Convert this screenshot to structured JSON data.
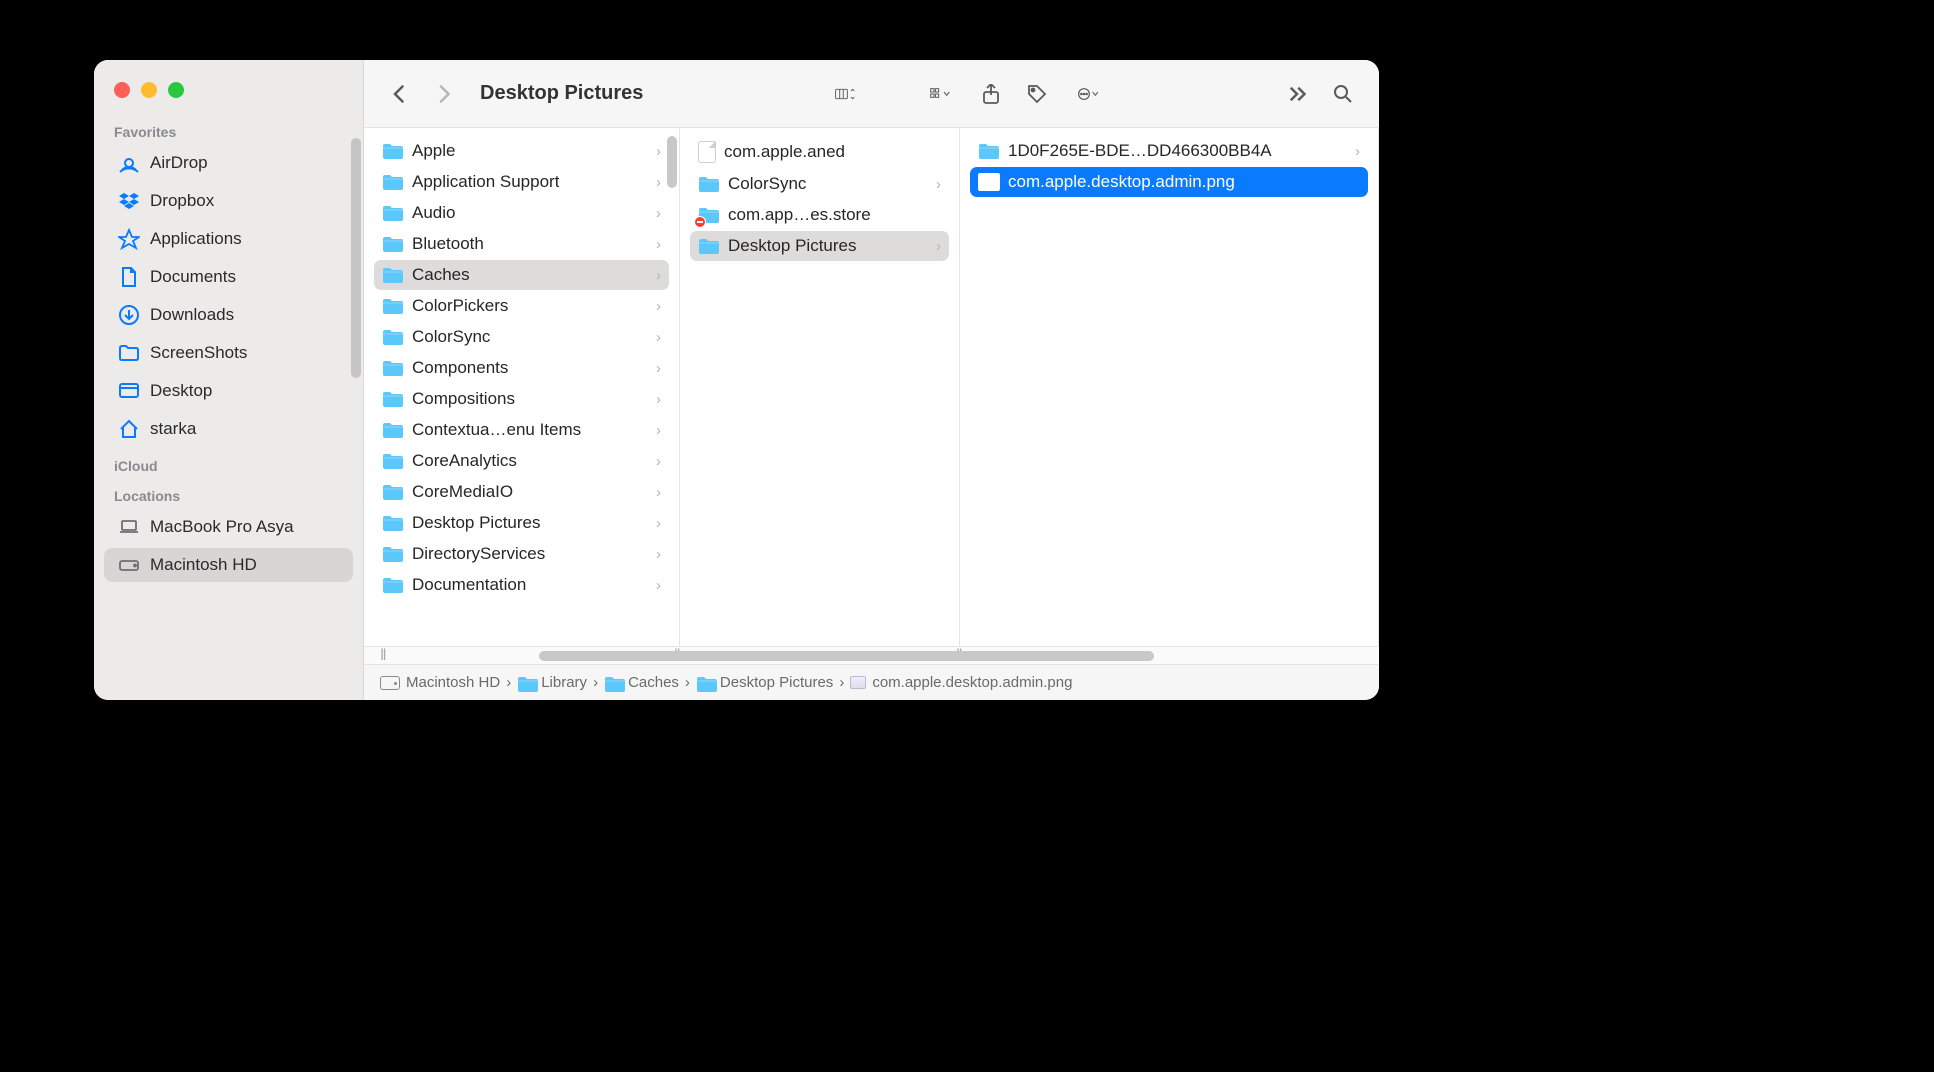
{
  "window": {
    "title": "Desktop Pictures"
  },
  "sidebar": {
    "sections": {
      "favorites": {
        "label": "Favorites",
        "items": [
          {
            "icon": "airdrop",
            "label": "AirDrop"
          },
          {
            "icon": "dropbox",
            "label": "Dropbox"
          },
          {
            "icon": "applications",
            "label": "Applications"
          },
          {
            "icon": "documents",
            "label": "Documents"
          },
          {
            "icon": "downloads",
            "label": "Downloads"
          },
          {
            "icon": "folder",
            "label": "ScreenShots"
          },
          {
            "icon": "desktop",
            "label": "Desktop"
          },
          {
            "icon": "home",
            "label": "starka"
          }
        ]
      },
      "icloud": {
        "label": "iCloud"
      },
      "locations": {
        "label": "Locations",
        "items": [
          {
            "icon": "laptop",
            "label": "MacBook Pro Asya"
          },
          {
            "icon": "hd",
            "label": "Macintosh HD",
            "selected": true
          }
        ]
      }
    }
  },
  "columns": [
    {
      "selected_index": 4,
      "items": [
        {
          "type": "folder",
          "label": "Apple",
          "chevron": true
        },
        {
          "type": "folder",
          "label": "Application Support",
          "chevron": true
        },
        {
          "type": "folder",
          "label": "Audio",
          "chevron": true
        },
        {
          "type": "folder",
          "label": "Bluetooth",
          "chevron": true
        },
        {
          "type": "folder",
          "label": "Caches",
          "chevron": true
        },
        {
          "type": "folder",
          "label": "ColorPickers",
          "chevron": true
        },
        {
          "type": "folder",
          "label": "ColorSync",
          "chevron": true
        },
        {
          "type": "folder",
          "label": "Components",
          "chevron": true
        },
        {
          "type": "folder",
          "label": "Compositions",
          "chevron": true
        },
        {
          "type": "folder",
          "label": "Contextua…enu Items",
          "chevron": true
        },
        {
          "type": "folder",
          "label": "CoreAnalytics",
          "chevron": true
        },
        {
          "type": "folder",
          "label": "CoreMediaIO",
          "chevron": true
        },
        {
          "type": "folder",
          "label": "Desktop Pictures",
          "chevron": true
        },
        {
          "type": "folder",
          "label": "DirectoryServices",
          "chevron": true
        },
        {
          "type": "folder",
          "label": "Documentation",
          "chevron": true
        }
      ]
    },
    {
      "selected_index": 3,
      "items": [
        {
          "type": "file",
          "label": "com.apple.aned"
        },
        {
          "type": "folder",
          "label": "ColorSync",
          "chevron": true
        },
        {
          "type": "folder",
          "label": "com.app…es.store",
          "denied": true
        },
        {
          "type": "folder",
          "label": "Desktop Pictures",
          "chevron": true
        }
      ]
    },
    {
      "selected_index": 1,
      "blue_select": true,
      "items": [
        {
          "type": "folder",
          "label": "1D0F265E-BDE…DD466300BB4A",
          "chevron": true
        },
        {
          "type": "image",
          "label": "com.apple.desktop.admin.png"
        }
      ]
    }
  ],
  "pathbar": [
    {
      "icon": "hd",
      "label": "Macintosh HD"
    },
    {
      "icon": "folder",
      "label": "Library"
    },
    {
      "icon": "folder",
      "label": "Caches"
    },
    {
      "icon": "folder",
      "label": "Desktop Pictures"
    },
    {
      "icon": "image",
      "label": "com.apple.desktop.admin.png"
    }
  ]
}
